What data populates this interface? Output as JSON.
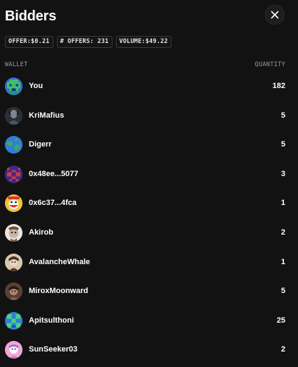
{
  "header": {
    "title": "Bidders"
  },
  "stats": {
    "offer": "OFFER:$0.21",
    "offers_count": "# OFFERS: 231",
    "volume": "VOLUME:$49.22"
  },
  "columns": {
    "wallet": "WALLET",
    "quantity": "QUANTITY"
  },
  "bidders": [
    {
      "name": "You",
      "quantity": "182",
      "avatar": "pixel-blue-green-avatar"
    },
    {
      "name": "KriMafius",
      "quantity": "5",
      "avatar": "dark-photo-avatar"
    },
    {
      "name": "Digerr",
      "quantity": "5",
      "avatar": "globe-avatar"
    },
    {
      "name": "0x48ee...5077",
      "quantity": "3",
      "avatar": "pixel-purple-red-avatar"
    },
    {
      "name": "0x6c37...4fca",
      "quantity": "1",
      "avatar": "yellow-red-cartoon-avatar"
    },
    {
      "name": "Akirob",
      "quantity": "2",
      "avatar": "white-cartoon-avatar"
    },
    {
      "name": "AvalancheWhale",
      "quantity": "1",
      "avatar": "beige-character-avatar"
    },
    {
      "name": "MiroxMoonward",
      "quantity": "5",
      "avatar": "brown-character-avatar"
    },
    {
      "name": "Apitsulthoni",
      "quantity": "25",
      "avatar": "pixel-blue-green-avatar"
    },
    {
      "name": "SunSeeker03",
      "quantity": "2",
      "avatar": "pink-character-avatar"
    }
  ]
}
